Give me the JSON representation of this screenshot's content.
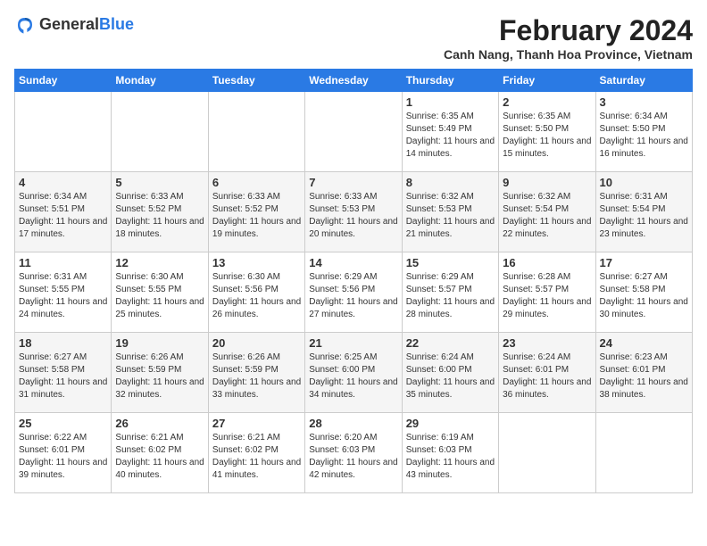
{
  "logo": {
    "general": "General",
    "blue": "Blue"
  },
  "title": {
    "month_year": "February 2024",
    "location": "Canh Nang, Thanh Hoa Province, Vietnam"
  },
  "headers": [
    "Sunday",
    "Monday",
    "Tuesday",
    "Wednesday",
    "Thursday",
    "Friday",
    "Saturday"
  ],
  "weeks": [
    [
      {
        "day": "",
        "sunrise": "",
        "sunset": "",
        "daylight": ""
      },
      {
        "day": "",
        "sunrise": "",
        "sunset": "",
        "daylight": ""
      },
      {
        "day": "",
        "sunrise": "",
        "sunset": "",
        "daylight": ""
      },
      {
        "day": "",
        "sunrise": "",
        "sunset": "",
        "daylight": ""
      },
      {
        "day": "1",
        "sunrise": "Sunrise: 6:35 AM",
        "sunset": "Sunset: 5:49 PM",
        "daylight": "Daylight: 11 hours and 14 minutes."
      },
      {
        "day": "2",
        "sunrise": "Sunrise: 6:35 AM",
        "sunset": "Sunset: 5:50 PM",
        "daylight": "Daylight: 11 hours and 15 minutes."
      },
      {
        "day": "3",
        "sunrise": "Sunrise: 6:34 AM",
        "sunset": "Sunset: 5:50 PM",
        "daylight": "Daylight: 11 hours and 16 minutes."
      }
    ],
    [
      {
        "day": "4",
        "sunrise": "Sunrise: 6:34 AM",
        "sunset": "Sunset: 5:51 PM",
        "daylight": "Daylight: 11 hours and 17 minutes."
      },
      {
        "day": "5",
        "sunrise": "Sunrise: 6:33 AM",
        "sunset": "Sunset: 5:52 PM",
        "daylight": "Daylight: 11 hours and 18 minutes."
      },
      {
        "day": "6",
        "sunrise": "Sunrise: 6:33 AM",
        "sunset": "Sunset: 5:52 PM",
        "daylight": "Daylight: 11 hours and 19 minutes."
      },
      {
        "day": "7",
        "sunrise": "Sunrise: 6:33 AM",
        "sunset": "Sunset: 5:53 PM",
        "daylight": "Daylight: 11 hours and 20 minutes."
      },
      {
        "day": "8",
        "sunrise": "Sunrise: 6:32 AM",
        "sunset": "Sunset: 5:53 PM",
        "daylight": "Daylight: 11 hours and 21 minutes."
      },
      {
        "day": "9",
        "sunrise": "Sunrise: 6:32 AM",
        "sunset": "Sunset: 5:54 PM",
        "daylight": "Daylight: 11 hours and 22 minutes."
      },
      {
        "day": "10",
        "sunrise": "Sunrise: 6:31 AM",
        "sunset": "Sunset: 5:54 PM",
        "daylight": "Daylight: 11 hours and 23 minutes."
      }
    ],
    [
      {
        "day": "11",
        "sunrise": "Sunrise: 6:31 AM",
        "sunset": "Sunset: 5:55 PM",
        "daylight": "Daylight: 11 hours and 24 minutes."
      },
      {
        "day": "12",
        "sunrise": "Sunrise: 6:30 AM",
        "sunset": "Sunset: 5:55 PM",
        "daylight": "Daylight: 11 hours and 25 minutes."
      },
      {
        "day": "13",
        "sunrise": "Sunrise: 6:30 AM",
        "sunset": "Sunset: 5:56 PM",
        "daylight": "Daylight: 11 hours and 26 minutes."
      },
      {
        "day": "14",
        "sunrise": "Sunrise: 6:29 AM",
        "sunset": "Sunset: 5:56 PM",
        "daylight": "Daylight: 11 hours and 27 minutes."
      },
      {
        "day": "15",
        "sunrise": "Sunrise: 6:29 AM",
        "sunset": "Sunset: 5:57 PM",
        "daylight": "Daylight: 11 hours and 28 minutes."
      },
      {
        "day": "16",
        "sunrise": "Sunrise: 6:28 AM",
        "sunset": "Sunset: 5:57 PM",
        "daylight": "Daylight: 11 hours and 29 minutes."
      },
      {
        "day": "17",
        "sunrise": "Sunrise: 6:27 AM",
        "sunset": "Sunset: 5:58 PM",
        "daylight": "Daylight: 11 hours and 30 minutes."
      }
    ],
    [
      {
        "day": "18",
        "sunrise": "Sunrise: 6:27 AM",
        "sunset": "Sunset: 5:58 PM",
        "daylight": "Daylight: 11 hours and 31 minutes."
      },
      {
        "day": "19",
        "sunrise": "Sunrise: 6:26 AM",
        "sunset": "Sunset: 5:59 PM",
        "daylight": "Daylight: 11 hours and 32 minutes."
      },
      {
        "day": "20",
        "sunrise": "Sunrise: 6:26 AM",
        "sunset": "Sunset: 5:59 PM",
        "daylight": "Daylight: 11 hours and 33 minutes."
      },
      {
        "day": "21",
        "sunrise": "Sunrise: 6:25 AM",
        "sunset": "Sunset: 6:00 PM",
        "daylight": "Daylight: 11 hours and 34 minutes."
      },
      {
        "day": "22",
        "sunrise": "Sunrise: 6:24 AM",
        "sunset": "Sunset: 6:00 PM",
        "daylight": "Daylight: 11 hours and 35 minutes."
      },
      {
        "day": "23",
        "sunrise": "Sunrise: 6:24 AM",
        "sunset": "Sunset: 6:01 PM",
        "daylight": "Daylight: 11 hours and 36 minutes."
      },
      {
        "day": "24",
        "sunrise": "Sunrise: 6:23 AM",
        "sunset": "Sunset: 6:01 PM",
        "daylight": "Daylight: 11 hours and 38 minutes."
      }
    ],
    [
      {
        "day": "25",
        "sunrise": "Sunrise: 6:22 AM",
        "sunset": "Sunset: 6:01 PM",
        "daylight": "Daylight: 11 hours and 39 minutes."
      },
      {
        "day": "26",
        "sunrise": "Sunrise: 6:21 AM",
        "sunset": "Sunset: 6:02 PM",
        "daylight": "Daylight: 11 hours and 40 minutes."
      },
      {
        "day": "27",
        "sunrise": "Sunrise: 6:21 AM",
        "sunset": "Sunset: 6:02 PM",
        "daylight": "Daylight: 11 hours and 41 minutes."
      },
      {
        "day": "28",
        "sunrise": "Sunrise: 6:20 AM",
        "sunset": "Sunset: 6:03 PM",
        "daylight": "Daylight: 11 hours and 42 minutes."
      },
      {
        "day": "29",
        "sunrise": "Sunrise: 6:19 AM",
        "sunset": "Sunset: 6:03 PM",
        "daylight": "Daylight: 11 hours and 43 minutes."
      },
      {
        "day": "",
        "sunrise": "",
        "sunset": "",
        "daylight": ""
      },
      {
        "day": "",
        "sunrise": "",
        "sunset": "",
        "daylight": ""
      }
    ]
  ]
}
